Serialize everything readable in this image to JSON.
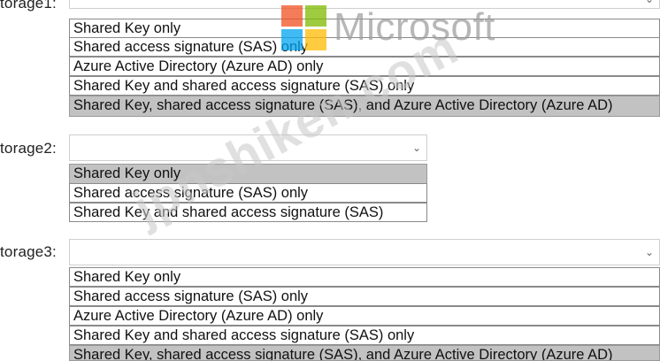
{
  "watermark": {
    "brand_text": "Microsoft",
    "site_text": "jpnshiken.com",
    "logo_colors": [
      "#f25022",
      "#7fba00",
      "#00a4ef",
      "#ffb900"
    ]
  },
  "storage1": {
    "label": "torage1:",
    "options": [
      "Shared Key only",
      "Shared access signature (SAS) only",
      "Azure Active Directory (Azure AD) only",
      "Shared Key and shared access signature (SAS) only",
      "Shared Key, shared access signature (SAS), and Azure Active Directory (Azure AD)"
    ],
    "selected": "Shared Key, shared access signature (SAS), and Azure Active Directory (Azure AD)"
  },
  "storage2": {
    "label": "torage2:",
    "options": [
      "Shared Key only",
      "Shared access signature (SAS) only",
      "Shared Key and shared access signature (SAS)"
    ],
    "selected": "Shared Key only"
  },
  "storage3": {
    "label": "torage3:",
    "options": [
      "Shared Key only",
      "Shared access signature (SAS) only",
      "Azure Active Directory (Azure AD) only",
      "Shared Key and shared access signature (SAS) only",
      "Shared Key, shared access signature (SAS), and Azure Active Directory (Azure AD)"
    ],
    "selected": "Shared Key, shared access signature (SAS), and Azure Active Directory (Azure AD)"
  },
  "icons": {
    "dropdown": "chevron-down-icon"
  }
}
